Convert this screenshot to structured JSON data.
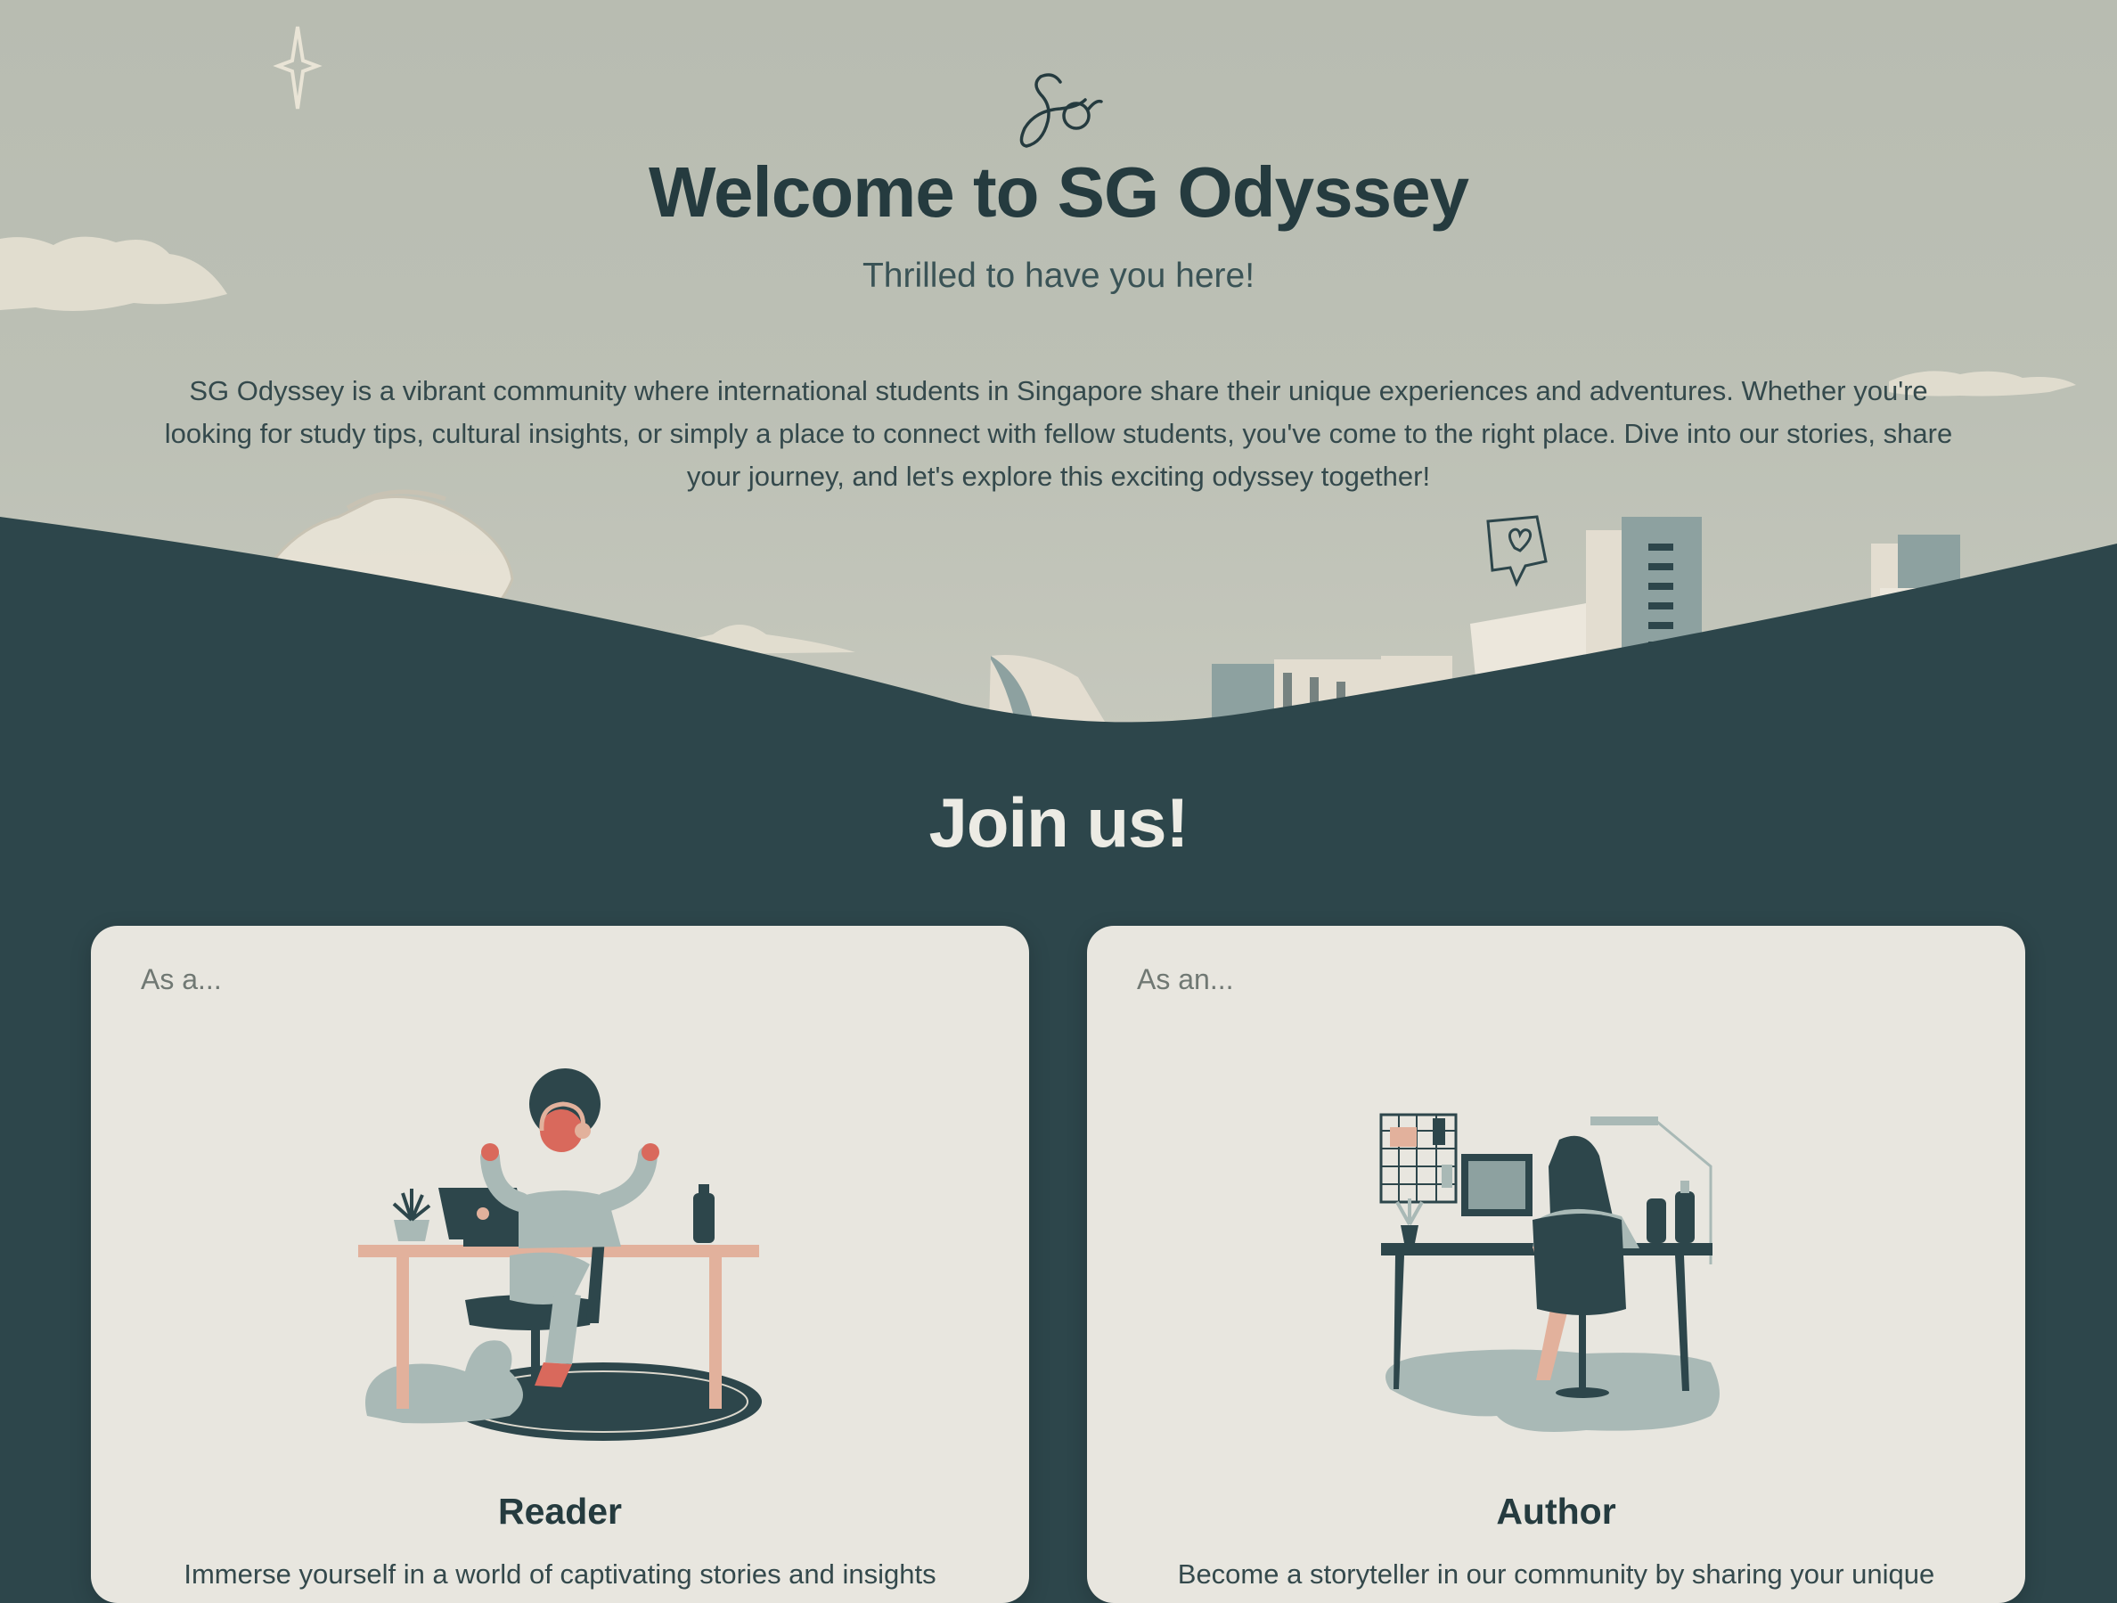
{
  "hero": {
    "logo_text": "Sg",
    "title": "Welcome to SG Odyssey",
    "subtitle": "Thrilled to have you here!",
    "description": "SG Odyssey is a vibrant community where international students in Singapore share their unique experiences and adventures. Whether you're looking for study tips, cultural insights, or simply a place to connect with fellow students, you've come to the right place. Dive into our stories, share your journey, and let's explore this exciting odyssey together!"
  },
  "join": {
    "title": "Join us!",
    "cards": [
      {
        "kicker": "As a...",
        "role": "Reader",
        "text": "Immerse yourself in a world of captivating stories and insights",
        "illustration": "reader-at-desk-illustration"
      },
      {
        "kicker": "As an...",
        "role": "Author",
        "text": "Become a storyteller in our community by sharing your unique",
        "illustration": "author-at-desk-illustration"
      }
    ]
  },
  "colors": {
    "hero_bg": "#b8bcb1",
    "dark_teal": "#2d464b",
    "heading": "#253b3f",
    "card_bg": "#e8e6df",
    "accent_peach": "#e2b19c",
    "accent_red": "#d9695c",
    "sage": "#a9b9b6"
  }
}
